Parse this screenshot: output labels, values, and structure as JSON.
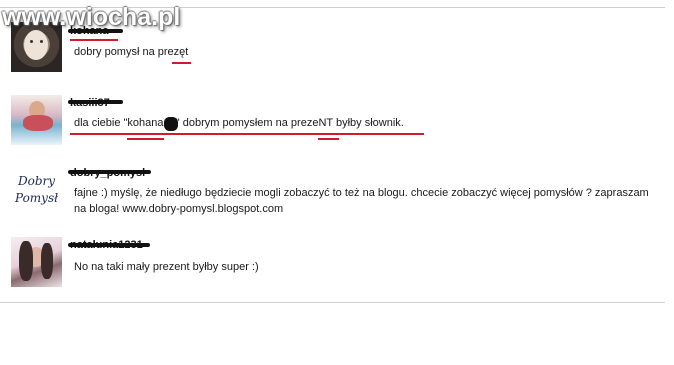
{
  "watermark": "www.wiocha.pl",
  "comments": [
    {
      "username": "kohana",
      "text": "dobry pomysł na prezęt"
    },
    {
      "username": "kasiii87",
      "text": "dla ciebie \"kohana18\" dobrym pomysłem na prezeNT byłby słownik."
    },
    {
      "username": "dobry_pomysl",
      "avatar_text": "Dobry Pomysł",
      "text": "fajne :) myślę, że niedługo będziecie mogli zobaczyć to też na blogu. chcecie zobaczyć więcej pomysłów ? zapraszam na bloga! www.dobry-pomysl.blogspot.com"
    },
    {
      "username": "natalunia1231",
      "text": "No na taki mały prezent byłby super :)"
    }
  ],
  "colors": {
    "underline": "#d11b2c",
    "rule": "#cfcfcf"
  }
}
